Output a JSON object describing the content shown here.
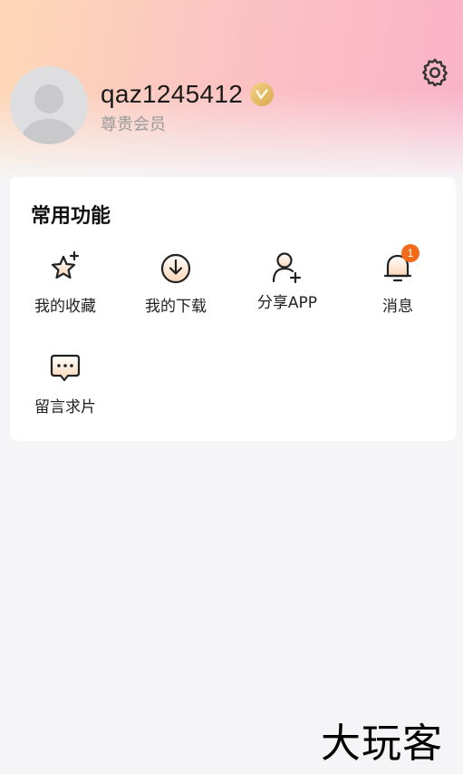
{
  "profile": {
    "username": "qaz1245412",
    "member_level": "尊贵会员",
    "icons": {
      "avatar": "default-avatar-icon",
      "vip": "vip-check-badge-icon",
      "settings": "gear-icon"
    }
  },
  "functions": {
    "title": "常用功能",
    "items": [
      {
        "label": "我的收藏",
        "icon": "star-sparkle-icon"
      },
      {
        "label": "我的下载",
        "icon": "download-circle-icon"
      },
      {
        "label": "分享APP",
        "icon": "add-user-icon"
      },
      {
        "label": "消息",
        "icon": "bell-icon",
        "badge": "1"
      },
      {
        "label": "留言求片",
        "icon": "chat-bubble-icon"
      }
    ]
  },
  "watermark": "大玩客",
  "colors": {
    "accent": "#f26b1d",
    "icon_gradient_light": "#fde3cf",
    "header_gradient": [
      "#fdd8b6",
      "#fcc4c2",
      "#f9b2c9"
    ]
  }
}
